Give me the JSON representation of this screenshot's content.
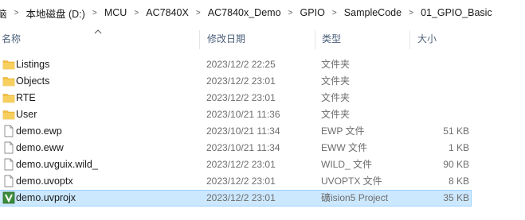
{
  "breadcrumb": [
    "脑",
    "本地磁盘 (D:)",
    "MCU",
    "AC7840X",
    "AC7840x_Demo",
    "GPIO",
    "SampleCode",
    "01_GPIO_Basic"
  ],
  "breadcrumb_separator": ">",
  "columns": {
    "name": "名称",
    "date": "修改日期",
    "type": "类型",
    "size": "大小"
  },
  "files": [
    {
      "icon": "folder-icon",
      "name": "Listings",
      "date": "2023/12/2 22:25",
      "type": "文件夹",
      "size": ""
    },
    {
      "icon": "folder-icon",
      "name": "Objects",
      "date": "2023/12/2 23:01",
      "type": "文件夹",
      "size": ""
    },
    {
      "icon": "folder-icon",
      "name": "RTE",
      "date": "2023/12/2 23:01",
      "type": "文件夹",
      "size": ""
    },
    {
      "icon": "folder-icon",
      "name": "User",
      "date": "2023/10/21 11:36",
      "type": "文件夹",
      "size": ""
    },
    {
      "icon": "file-icon",
      "name": "demo.ewp",
      "date": "2023/10/21 11:34",
      "type": "EWP 文件",
      "size": "51 KB"
    },
    {
      "icon": "file-icon",
      "name": "demo.eww",
      "date": "2023/10/21 11:34",
      "type": "EWW 文件",
      "size": "1 KB"
    },
    {
      "icon": "file-icon",
      "name": "demo.uvguix.wild_",
      "date": "2023/12/2 23:01",
      "type": "WILD_ 文件",
      "size": "90 KB"
    },
    {
      "icon": "file-icon",
      "name": "demo.uvoptx",
      "date": "2023/12/2 23:01",
      "type": "UVOPTX 文件",
      "size": "8 KB"
    },
    {
      "icon": "keil-project-icon",
      "name": "demo.uvprojx",
      "date": "2023/12/2 23:01",
      "type": "礦ision5 Project",
      "size": "35 KB"
    }
  ],
  "selected_row": 8,
  "colors": {
    "folder": "#f4c044",
    "selection": "#cce8ff",
    "selection_border": "#99d1ff",
    "header_text": "#4c607a",
    "keil_green": "#3c8c3c"
  }
}
